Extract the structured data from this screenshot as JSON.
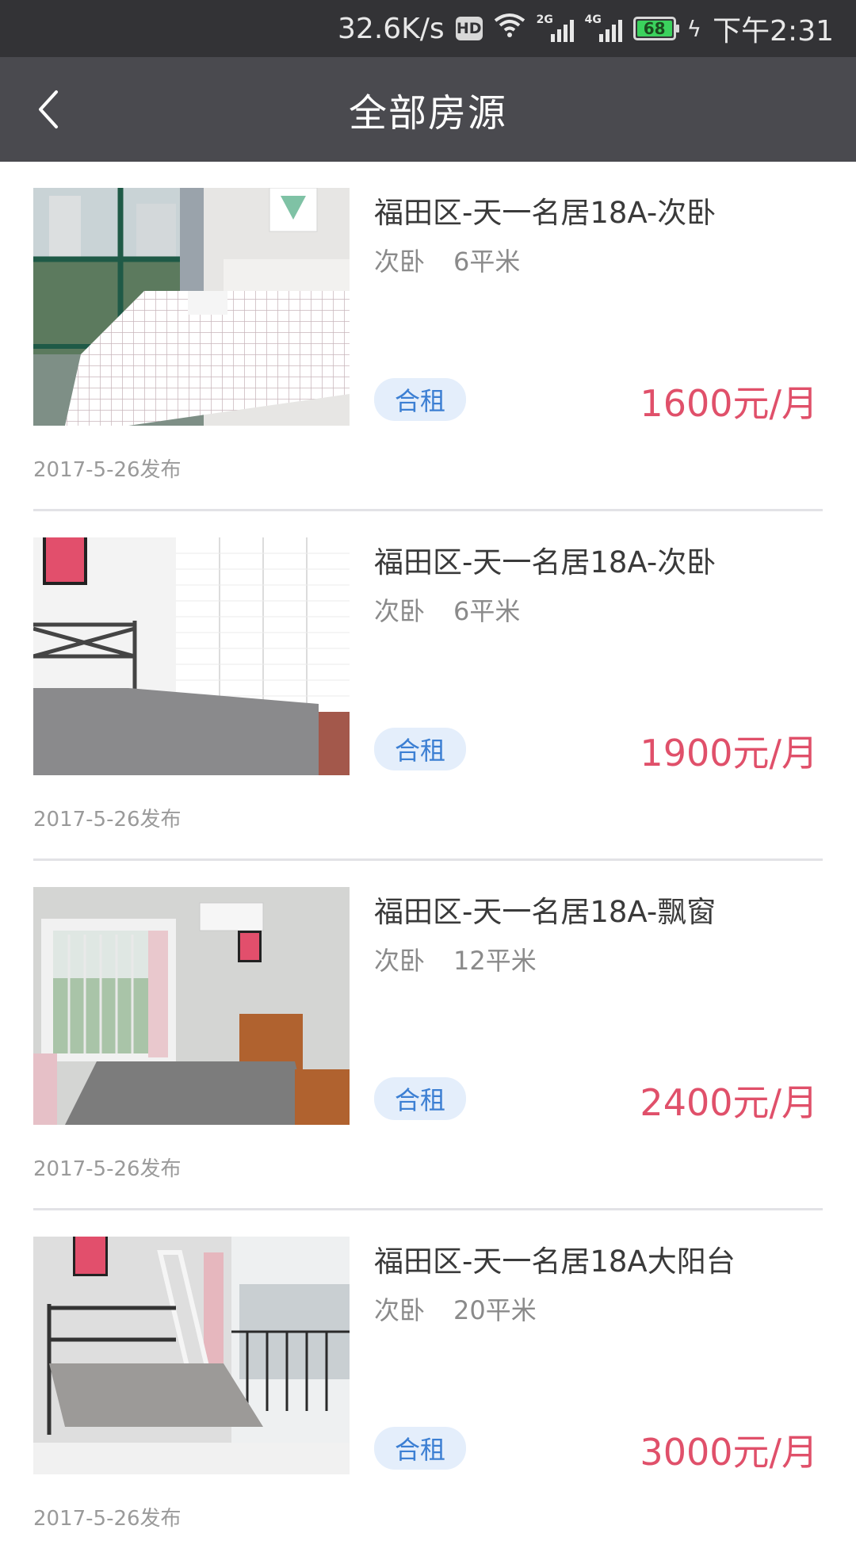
{
  "status_bar": {
    "speed": "32.6K/s",
    "hd": "HD",
    "signal1_tag": "2G",
    "signal2_tag": "4G",
    "battery": "68",
    "time": "下午2:31"
  },
  "header": {
    "title": "全部房源"
  },
  "listings": [
    {
      "title": "福田区-天一名居18A-次卧",
      "room_type": "次卧",
      "area": "6平米",
      "tag": "合租",
      "price": "1600元/月",
      "date": "2017-5-26发布"
    },
    {
      "title": "福田区-天一名居18A-次卧",
      "room_type": "次卧",
      "area": "6平米",
      "tag": "合租",
      "price": "1900元/月",
      "date": "2017-5-26发布"
    },
    {
      "title": "福田区-天一名居18A-飘窗",
      "room_type": "次卧",
      "area": "12平米",
      "tag": "合租",
      "price": "2400元/月",
      "date": "2017-5-26发布"
    },
    {
      "title": "福田区-天一名居18A大阳台",
      "room_type": "次卧",
      "area": "20平米",
      "tag": "合租",
      "price": "3000元/月",
      "date": "2017-5-26发布"
    }
  ],
  "colors": {
    "status_bar": "#333336",
    "nav_bar": "#4a4a4f",
    "price": "#e0506a",
    "tag_text": "#3c7fd3",
    "tag_bg": "#e4eefb"
  }
}
